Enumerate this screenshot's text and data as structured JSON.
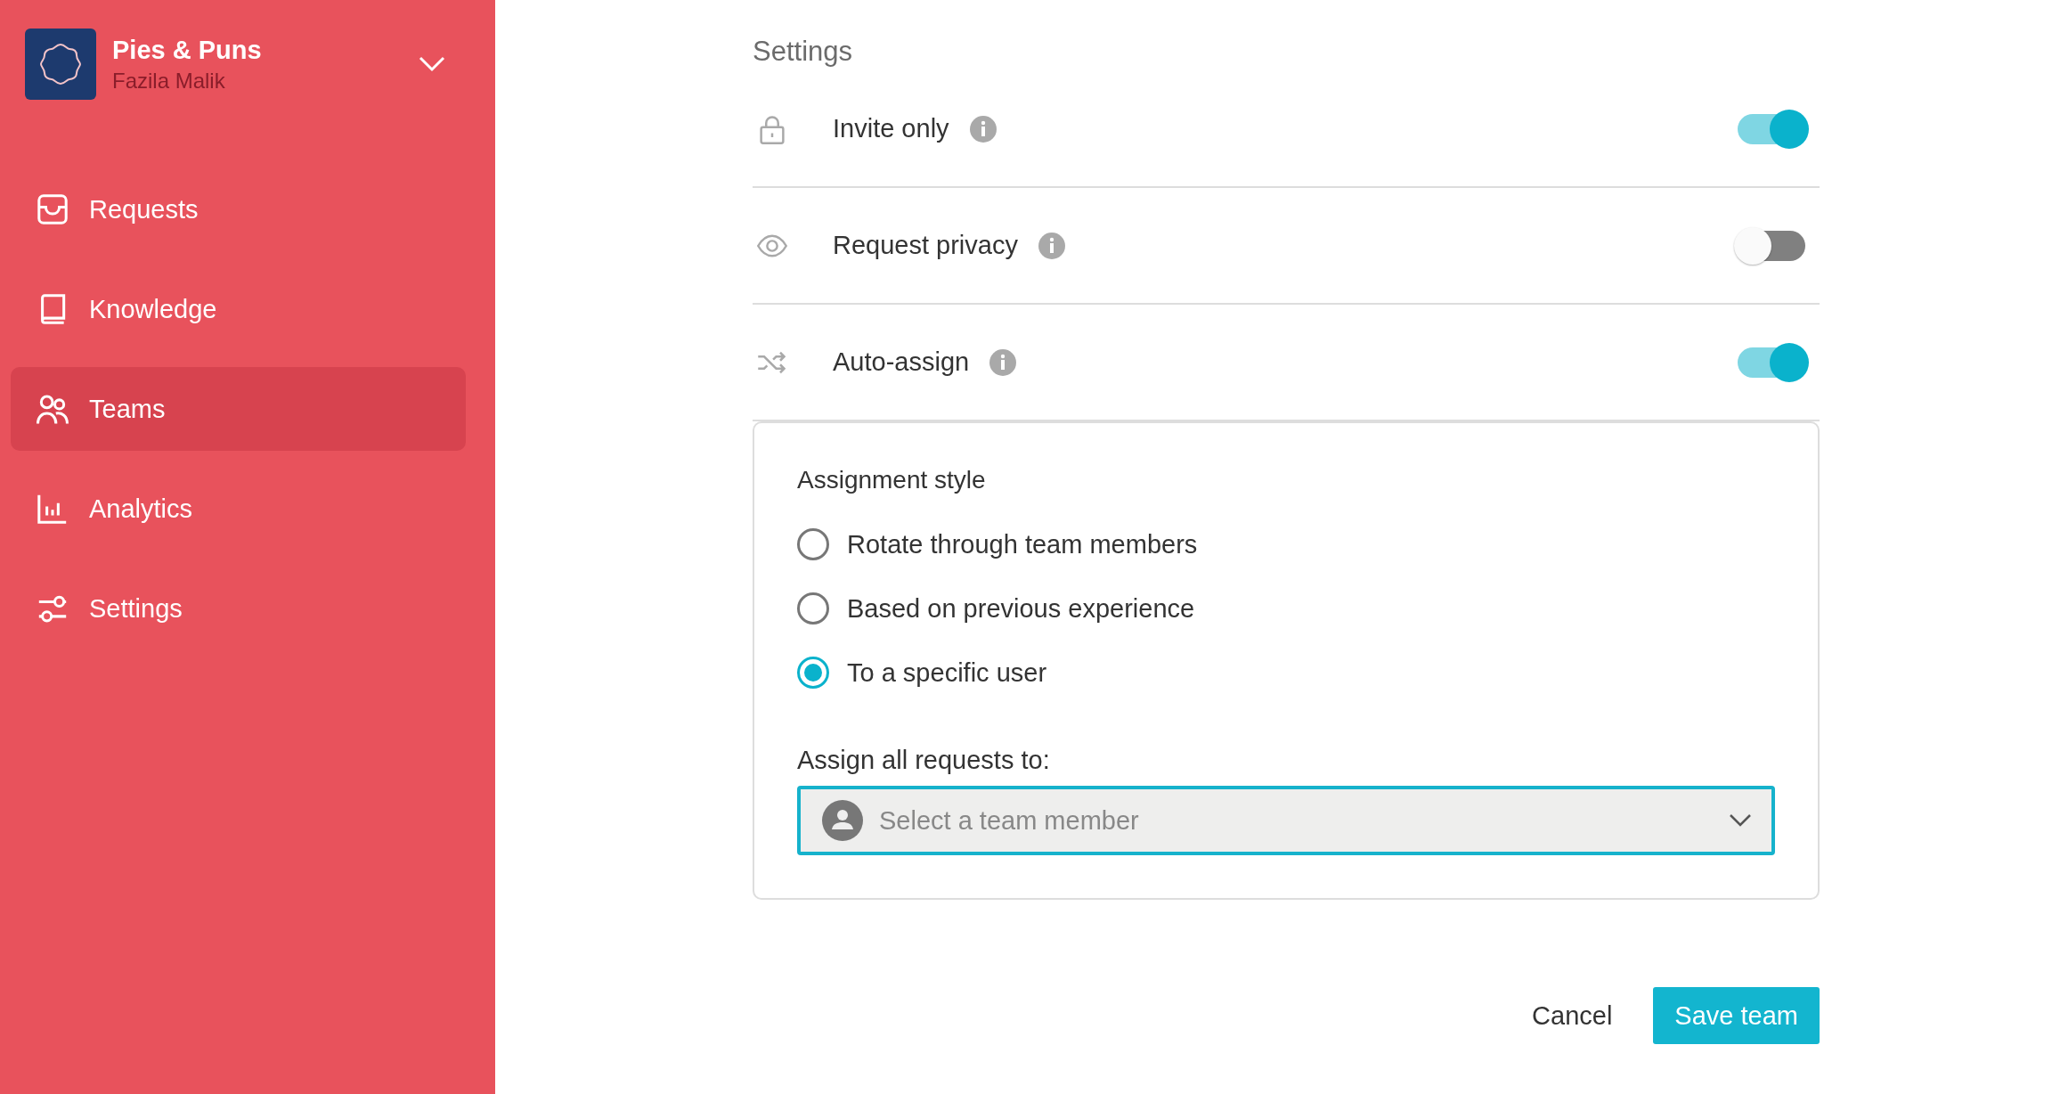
{
  "workspace": {
    "name": "Pies & Puns",
    "user": "Fazila Malik"
  },
  "nav": [
    {
      "label": "Requests",
      "selected": false
    },
    {
      "label": "Knowledge",
      "selected": false
    },
    {
      "label": "Teams",
      "selected": true
    },
    {
      "label": "Analytics",
      "selected": false
    },
    {
      "label": "Settings",
      "selected": false
    }
  ],
  "section_title": "Settings",
  "settings": [
    {
      "label": "Invite only",
      "on": true
    },
    {
      "label": "Request privacy",
      "on": false
    },
    {
      "label": "Auto-assign",
      "on": true
    }
  ],
  "assignment": {
    "title": "Assignment style",
    "options": [
      {
        "label": "Rotate through team members",
        "selected": false
      },
      {
        "label": "Based on previous experience",
        "selected": false
      },
      {
        "label": "To a specific user",
        "selected": true
      }
    ],
    "assign_label": "Assign all requests to:",
    "select": {
      "placeholder": "Select a team member"
    }
  },
  "buttons": {
    "cancel": "Cancel",
    "save": "Save team"
  }
}
